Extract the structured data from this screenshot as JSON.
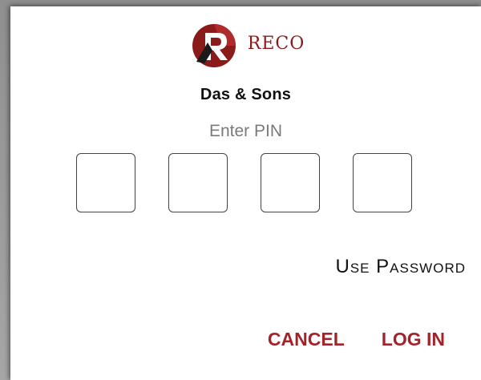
{
  "brand": {
    "name": "RECO",
    "logo_letter": "R",
    "logo_color": "#8b1a1a"
  },
  "company": {
    "name": "Das & Sons"
  },
  "pin": {
    "label": "Enter PIN",
    "digits": [
      "",
      "",
      "",
      ""
    ]
  },
  "use_password_label": "Use Password",
  "actions": {
    "cancel_label": "CANCEL",
    "login_label": "LOG IN",
    "accent_color": "#a3232a"
  }
}
